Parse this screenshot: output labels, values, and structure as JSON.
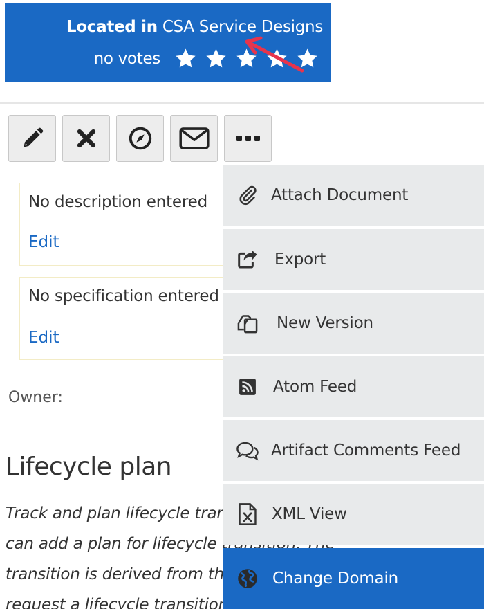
{
  "banner": {
    "located_label": "Located in",
    "location_name": "CSA Service Designs",
    "votes_label": "no votes",
    "star_count": 5
  },
  "toolbar": {
    "buttons": [
      {
        "name": "edit-button",
        "icon": "pencil-icon"
      },
      {
        "name": "delete-button",
        "icon": "close-icon"
      },
      {
        "name": "navigate-button",
        "icon": "compass-icon"
      },
      {
        "name": "email-button",
        "icon": "envelope-icon"
      },
      {
        "name": "more-button",
        "icon": "ellipsis-icon"
      }
    ]
  },
  "description_panel": {
    "text": "No description entered",
    "edit_label": "Edit"
  },
  "specification_panel": {
    "text": "No specification entered",
    "edit_label": "Edit"
  },
  "owner": {
    "label": "Owner:"
  },
  "lifecycle": {
    "heading": "Lifecycle plan",
    "description_lines": [
      "Track and plan lifecycle transitions. You",
      "can add a plan for lifecycle transition. The",
      "transition is derived from the lifecycle. You can",
      "request a lifecycle transition."
    ]
  },
  "more_menu": {
    "items": [
      {
        "label": "Attach Document",
        "icon": "paperclip-icon"
      },
      {
        "label": "Export",
        "icon": "share-icon"
      },
      {
        "label": "New Version",
        "icon": "copy-icon"
      },
      {
        "label": "Atom Feed",
        "icon": "rss-icon"
      },
      {
        "label": "Artifact Comments Feed",
        "icon": "comments-icon"
      },
      {
        "label": "XML View",
        "icon": "xml-file-icon"
      },
      {
        "label": "Change Domain",
        "icon": "globe-icon"
      }
    ],
    "active_index": 6
  },
  "colors": {
    "accent": "#1a69c4",
    "menu_bg": "#e8eaeb",
    "annotation_arrow": "#e8344c"
  }
}
